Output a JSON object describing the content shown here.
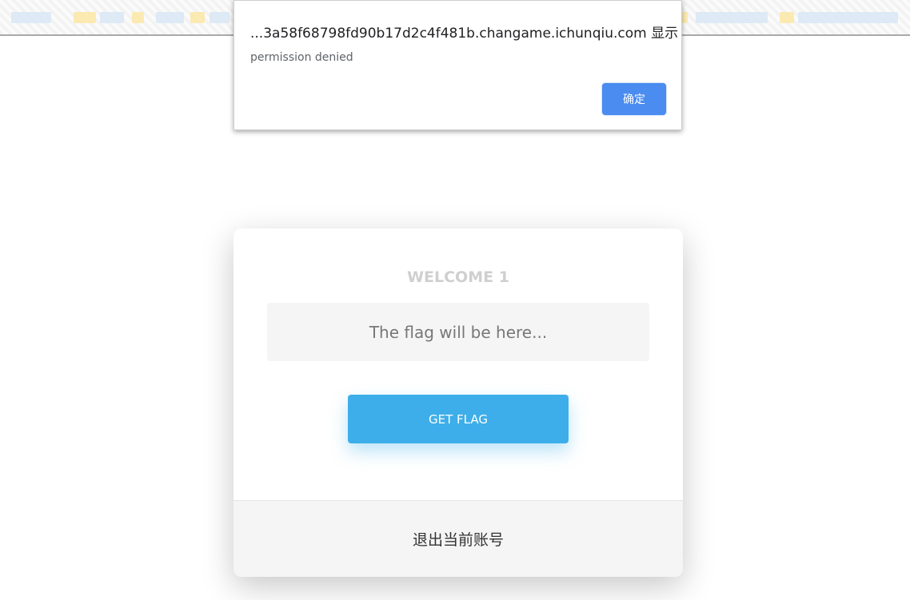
{
  "alert": {
    "title": "...3a58f68798fd90b17d2c4f481b.changame.ichunqiu.com 显示",
    "message": "permission denied",
    "ok_label": "确定"
  },
  "card": {
    "welcome": "WELCOME 1",
    "flag_placeholder": "The flag will be here...",
    "get_flag_label": "GET FLAG",
    "logout_label": "退出当前账号"
  },
  "colors": {
    "alert_button": "#4a8cf0",
    "get_flag_button": "#3daee9",
    "welcome_text": "#cfcfcf"
  }
}
